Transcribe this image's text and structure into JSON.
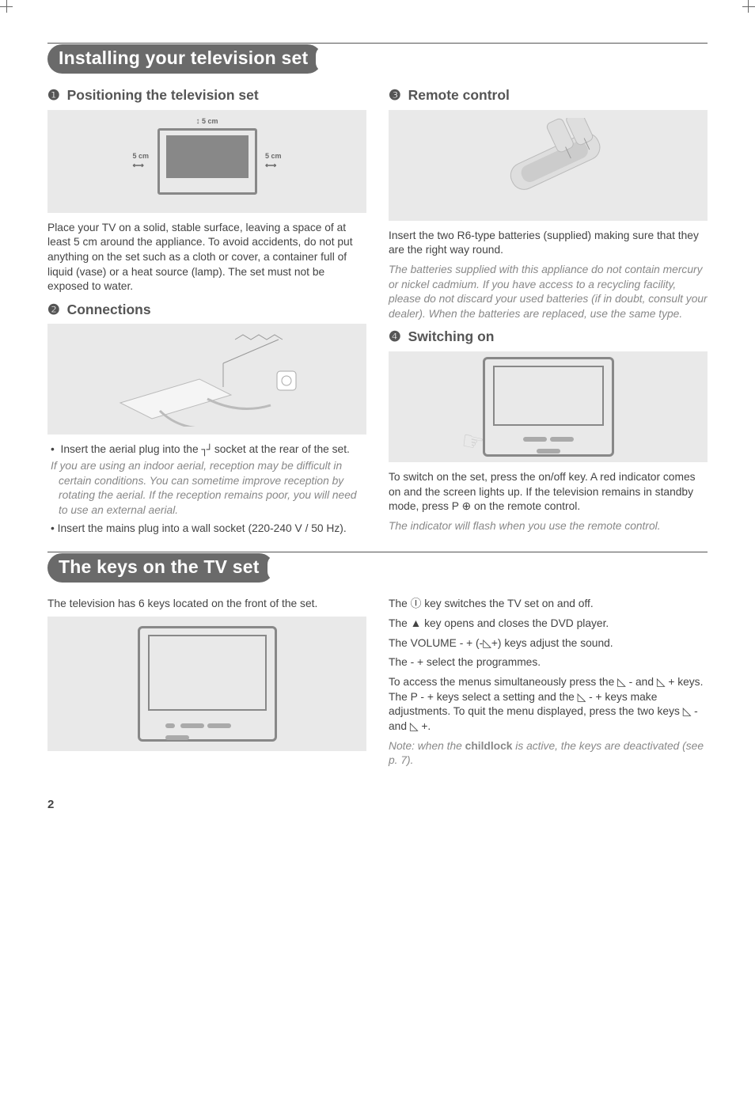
{
  "section1": {
    "pill": "Installing your television set",
    "subheads": {
      "positioning": "Positioning the television set",
      "connections": "Connections",
      "remote": "Remote control",
      "switching": "Switching on"
    },
    "nums": {
      "n1": "❶",
      "n2": "❷",
      "n3": "❸",
      "n4": "❹"
    },
    "positioning_dims": {
      "top": "5 cm",
      "left": "5 cm",
      "right": "5 cm"
    },
    "positioning_body": "Place your TV on a solid, stable surface, leaving a space of at least 5 cm around the appliance. To avoid accidents, do not put anything on the set such as a cloth or cover, a container full of liquid (vase) or a heat source (lamp). The set must not be exposed to water.",
    "connections_bullet1_a": "Insert the aerial plug into the ",
    "connections_bullet1_b": " socket at the rear of the set.",
    "connections_italic": "If you are using an indoor aerial, reception may be difficult in certain conditions. You can sometime improve reception by rotating the aerial. If the reception remains poor, you will need to use an external aerial.",
    "connections_bullet2": "Insert the mains plug into a wall socket (220-240 V / 50 Hz).",
    "remote_body": "Insert the two R6-type batteries (supplied) making sure that they are the right way round.",
    "remote_italic": "The batteries supplied with this appliance do not contain mercury or nickel cadmium. If you have access to a recycling facility, please do not discard your used batteries (if in doubt, consult your dealer). When the batteries are replaced, use the same type.",
    "switching_body_a": "To switch on the set, press the on/off key. A red indicator comes on and the screen lights up. If the television remains in standby mode, press P ",
    "switching_body_b": " on the remote control.",
    "switching_italic": "The indicator will flash when you use the remote control."
  },
  "section2": {
    "pill": "The keys on the TV set",
    "intro": "The television has 6 keys located on the front of the set.",
    "right_lines": {
      "l1a": "The ",
      "power_icon": "Ⓘ",
      "l1b": " key switches the TV set on and off.",
      "l2a": "The ",
      "eject_icon": "▲",
      "l2b": " key opens and closes the DVD player.",
      "l3a": "The VOLUME - + (-",
      "vol_icon": "⫽",
      "l3b": "+) keys adjust the sound.",
      "l4": "The - + select the programmes.",
      "l5a": "To access the menus simultaneously press the ",
      "l5b": " - and ",
      "l5c": " + keys. The P - + keys select a setting and the ",
      "l5d": " - + keys make adjustments. To quit the menu displayed, press the two keys ",
      "l5e": " - and ",
      "l5f": " +.",
      "note_a": "Note: when the ",
      "note_bold": "childlock",
      "note_b": " is active, the keys are deactivated (see p. 7)."
    }
  },
  "page_number": "2"
}
